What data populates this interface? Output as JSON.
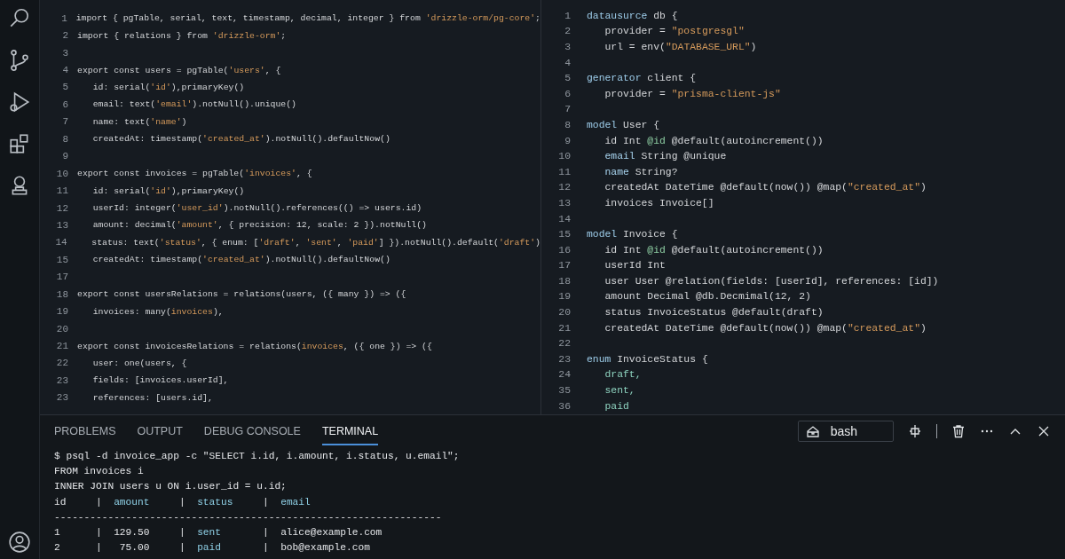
{
  "left_editor": {
    "lines": [
      {
        "n": "1",
        "tokens": [
          {
            "text": "import { pgTable, serial, text, timestamp, decimal, integer } from ",
            "kind": "plain"
          },
          {
            "text": "'drizzle-orm/pg-core'",
            "kind": "string"
          },
          {
            "text": ";",
            "kind": "plain"
          }
        ]
      },
      {
        "n": "2",
        "tokens": [
          {
            "text": "import { relations } from ",
            "kind": "plain"
          },
          {
            "text": "'drizzle-orm'",
            "kind": "string"
          },
          {
            "text": ";",
            "kind": "plain"
          }
        ]
      },
      {
        "n": "3"
      },
      {
        "n": "4",
        "tokens": [
          {
            "text": "export const users = pgTable(",
            "kind": "plain"
          },
          {
            "text": "'users'",
            "kind": "string"
          },
          {
            "text": ", {",
            "kind": "plain"
          }
        ]
      },
      {
        "n": "5",
        "tokens": [
          {
            "text": "   id: serial(",
            "kind": "plain"
          },
          {
            "text": "'id'",
            "kind": "string"
          },
          {
            "text": "),primaryKey()",
            "kind": "plain"
          }
        ]
      },
      {
        "n": "6",
        "tokens": [
          {
            "text": "   email: text(",
            "kind": "plain"
          },
          {
            "text": "'email'",
            "kind": "string"
          },
          {
            "text": ").notNull().unique()",
            "kind": "plain"
          }
        ]
      },
      {
        "n": "7",
        "tokens": [
          {
            "text": "   name: text(",
            "kind": "plain"
          },
          {
            "text": "'name'",
            "kind": "string"
          },
          {
            "text": ")",
            "kind": "plain"
          }
        ]
      },
      {
        "n": "8",
        "tokens": [
          {
            "text": "   createdAt: timestamp(",
            "kind": "plain"
          },
          {
            "text": "'created_at'",
            "kind": "string"
          },
          {
            "text": ").notNull().defaultNow()",
            "kind": "plain"
          }
        ]
      },
      {
        "n": "9"
      },
      {
        "n": "10",
        "tokens": [
          {
            "text": "export const invoices = pgTable(",
            "kind": "plain"
          },
          {
            "text": "'invoices'",
            "kind": "string"
          },
          {
            "text": ", {",
            "kind": "plain"
          }
        ]
      },
      {
        "n": "11",
        "tokens": [
          {
            "text": "   id: serial(",
            "kind": "plain"
          },
          {
            "text": "'id'",
            "kind": "string"
          },
          {
            "text": "),primaryKey()",
            "kind": "plain"
          }
        ]
      },
      {
        "n": "12",
        "tokens": [
          {
            "text": "   userId: integer(",
            "kind": "plain"
          },
          {
            "text": "'user_id'",
            "kind": "string"
          },
          {
            "text": ").notNull().references(() => users.id)",
            "kind": "plain"
          }
        ]
      },
      {
        "n": "13",
        "tokens": [
          {
            "text": "   amount: decimal(",
            "kind": "plain"
          },
          {
            "text": "'amount'",
            "kind": "string"
          },
          {
            "text": ", { precision: 12, scale: 2 }).notNull()",
            "kind": "plain"
          }
        ]
      },
      {
        "n": "14",
        "tokens": [
          {
            "text": "   status: text(",
            "kind": "plain"
          },
          {
            "text": "'status'",
            "kind": "string"
          },
          {
            "text": ", { enum: [",
            "kind": "plain"
          },
          {
            "text": "'draft'",
            "kind": "string"
          },
          {
            "text": ", ",
            "kind": "plain"
          },
          {
            "text": "'sent'",
            "kind": "string"
          },
          {
            "text": ", ",
            "kind": "plain"
          },
          {
            "text": "'paid'",
            "kind": "string"
          },
          {
            "text": "] }).notNull().default(",
            "kind": "plain"
          },
          {
            "text": "'draft'",
            "kind": "string"
          },
          {
            "text": ")",
            "kind": "plain"
          }
        ]
      },
      {
        "n": "15",
        "tokens": [
          {
            "text": "   createdAt: timestamp(",
            "kind": "plain"
          },
          {
            "text": "'created_at'",
            "kind": "string"
          },
          {
            "text": ").notNull().defaultNow()",
            "kind": "plain"
          }
        ]
      },
      {
        "n": "17"
      },
      {
        "n": "18",
        "tokens": [
          {
            "text": "export const usersRelations = relations(users, ({ many }) => ({",
            "kind": "plain"
          }
        ]
      },
      {
        "n": "19",
        "tokens": [
          {
            "text": "   invoices: many(",
            "kind": "plain"
          },
          {
            "text": "invoices",
            "kind": "string"
          },
          {
            "text": "),",
            "kind": "plain"
          }
        ]
      },
      {
        "n": "20"
      },
      {
        "n": "21",
        "tokens": [
          {
            "text": "export const invoicesRelations = relations(",
            "kind": "plain"
          },
          {
            "text": "invoices",
            "kind": "string"
          },
          {
            "text": ", ({ one }) => ({",
            "kind": "plain"
          }
        ]
      },
      {
        "n": "22",
        "tokens": [
          {
            "text": "   user: one(users, {",
            "kind": "plain"
          }
        ]
      },
      {
        "n": "23",
        "tokens": [
          {
            "text": "   fields: [invoices.userId],",
            "kind": "plain"
          }
        ]
      },
      {
        "n": "23",
        "tokens": [
          {
            "text": "   references: [users.id],",
            "kind": "plain"
          }
        ]
      }
    ]
  },
  "right_editor": {
    "lines": [
      {
        "n": "1",
        "tokens": [
          {
            "text": "datausurce",
            "kind": "keyword"
          },
          {
            "text": " db {",
            "kind": "plain"
          }
        ]
      },
      {
        "n": "2",
        "tokens": [
          {
            "text": "   provider = ",
            "kind": "plain"
          },
          {
            "text": "\"postgresgl\"",
            "kind": "string"
          }
        ]
      },
      {
        "n": "3",
        "tokens": [
          {
            "text": "   url = env(",
            "kind": "plain"
          },
          {
            "text": "\"DATABASE_URL\"",
            "kind": "string"
          },
          {
            "text": ")",
            "kind": "plain"
          }
        ]
      },
      {
        "n": "4"
      },
      {
        "n": "5",
        "tokens": [
          {
            "text": "generator",
            "kind": "keyword"
          },
          {
            "text": " client {",
            "kind": "plain"
          }
        ]
      },
      {
        "n": "6",
        "tokens": [
          {
            "text": "   provider = ",
            "kind": "plain"
          },
          {
            "text": "\"prisma-client-js\"",
            "kind": "string"
          }
        ]
      },
      {
        "n": "7"
      },
      {
        "n": "8",
        "tokens": [
          {
            "text": "model",
            "kind": "keyword"
          },
          {
            "text": " User {",
            "kind": "plain"
          }
        ]
      },
      {
        "n": "9",
        "tokens": [
          {
            "text": "   id Int ",
            "kind": "plain"
          },
          {
            "text": "@id",
            "kind": "decorator"
          },
          {
            "text": " @default(autoincrement())",
            "kind": "plain"
          }
        ]
      },
      {
        "n": "10",
        "tokens": [
          {
            "text": "   email",
            "kind": "field"
          },
          {
            "text": " String @unique",
            "kind": "plain"
          }
        ]
      },
      {
        "n": "11",
        "tokens": [
          {
            "text": "   name",
            "kind": "field"
          },
          {
            "text": " String?",
            "kind": "plain"
          }
        ]
      },
      {
        "n": "12",
        "tokens": [
          {
            "text": "   createdAt DateTime @default(now()) @map(",
            "kind": "plain"
          },
          {
            "text": "\"created_at\"",
            "kind": "string"
          },
          {
            "text": ")",
            "kind": "plain"
          }
        ]
      },
      {
        "n": "13",
        "tokens": [
          {
            "text": "   invoices Invoice[]",
            "kind": "plain"
          }
        ]
      },
      {
        "n": "14"
      },
      {
        "n": "15",
        "tokens": [
          {
            "text": "model",
            "kind": "keyword"
          },
          {
            "text": " Invoice {",
            "kind": "plain"
          }
        ]
      },
      {
        "n": "16",
        "tokens": [
          {
            "text": "   id Int ",
            "kind": "plain"
          },
          {
            "text": "@id",
            "kind": "decorator"
          },
          {
            "text": " @default(autoincrement())",
            "kind": "plain"
          }
        ]
      },
      {
        "n": "17",
        "tokens": [
          {
            "text": "   userId Int",
            "kind": "plain"
          }
        ]
      },
      {
        "n": "18",
        "tokens": [
          {
            "text": "   user User @relation(fields: [userId], references: [id])",
            "kind": "plain"
          }
        ]
      },
      {
        "n": "19",
        "tokens": [
          {
            "text": "   amount Decimal @db.Decmimal(12, 2)",
            "kind": "plain"
          }
        ]
      },
      {
        "n": "20",
        "tokens": [
          {
            "text": "   status InvoiceStatus @default(draft)",
            "kind": "plain"
          }
        ]
      },
      {
        "n": "21",
        "tokens": [
          {
            "text": "   createdAt DateTime @default(now()) @map(",
            "kind": "plain"
          },
          {
            "text": "\"created_at\"",
            "kind": "string"
          },
          {
            "text": ")",
            "kind": "plain"
          }
        ]
      },
      {
        "n": "22"
      },
      {
        "n": "23",
        "tokens": [
          {
            "text": "enum",
            "kind": "keyword"
          },
          {
            "text": " InvoiceStatus {",
            "kind": "plain"
          }
        ]
      },
      {
        "n": "24",
        "tokens": [
          {
            "text": "   draft,",
            "kind": "enum"
          }
        ]
      },
      {
        "n": "35",
        "tokens": [
          {
            "text": "   sent,",
            "kind": "enum"
          }
        ]
      },
      {
        "n": "36",
        "tokens": [
          {
            "text": "   paid",
            "kind": "enum"
          }
        ]
      }
    ]
  },
  "panel": {
    "tabs": [
      {
        "label": "PROBLEMS",
        "selected": false
      },
      {
        "label": "OUTPUT",
        "selected": false
      },
      {
        "label": "DEBUG CONSOLE",
        "selected": false
      },
      {
        "label": "TERMINAL",
        "selected": true
      }
    ],
    "shell": "bash",
    "terminal": {
      "lines": [
        {
          "tokens": [
            {
              "text": "$ psql -d invoice_app -c \"SELECT i.id, i.amount, i.status, u.email\";",
              "kind": "plain"
            }
          ]
        },
        {
          "tokens": [
            {
              "text": "FROM invoices i",
              "kind": "plain"
            }
          ]
        },
        {
          "tokens": [
            {
              "text": "INNER JOIN users u ON i.user_id = u.id;",
              "kind": "plain"
            }
          ]
        },
        {
          "tokens": [
            {
              "text": "id     |  ",
              "kind": "plain"
            },
            {
              "text": "amount",
              "kind": "accent"
            },
            {
              "text": "     |  ",
              "kind": "plain"
            },
            {
              "text": "status",
              "kind": "accent"
            },
            {
              "text": "     |  ",
              "kind": "plain"
            },
            {
              "text": "email",
              "kind": "accent"
            }
          ]
        },
        {
          "tokens": [
            {
              "text": "-----------------------------------------------------------------",
              "kind": "plain"
            }
          ]
        },
        {
          "tokens": [
            {
              "text": "1      |  129.50     |  ",
              "kind": "plain"
            },
            {
              "text": "sent",
              "kind": "accent"
            },
            {
              "text": "       |  alice@example.com",
              "kind": "plain"
            }
          ]
        },
        {
          "tokens": [
            {
              "text": "2      |   75.00     |  ",
              "kind": "plain"
            },
            {
              "text": "paid",
              "kind": "accent"
            },
            {
              "text": "       |  bob@example.com",
              "kind": "plain"
            }
          ]
        }
      ]
    }
  }
}
